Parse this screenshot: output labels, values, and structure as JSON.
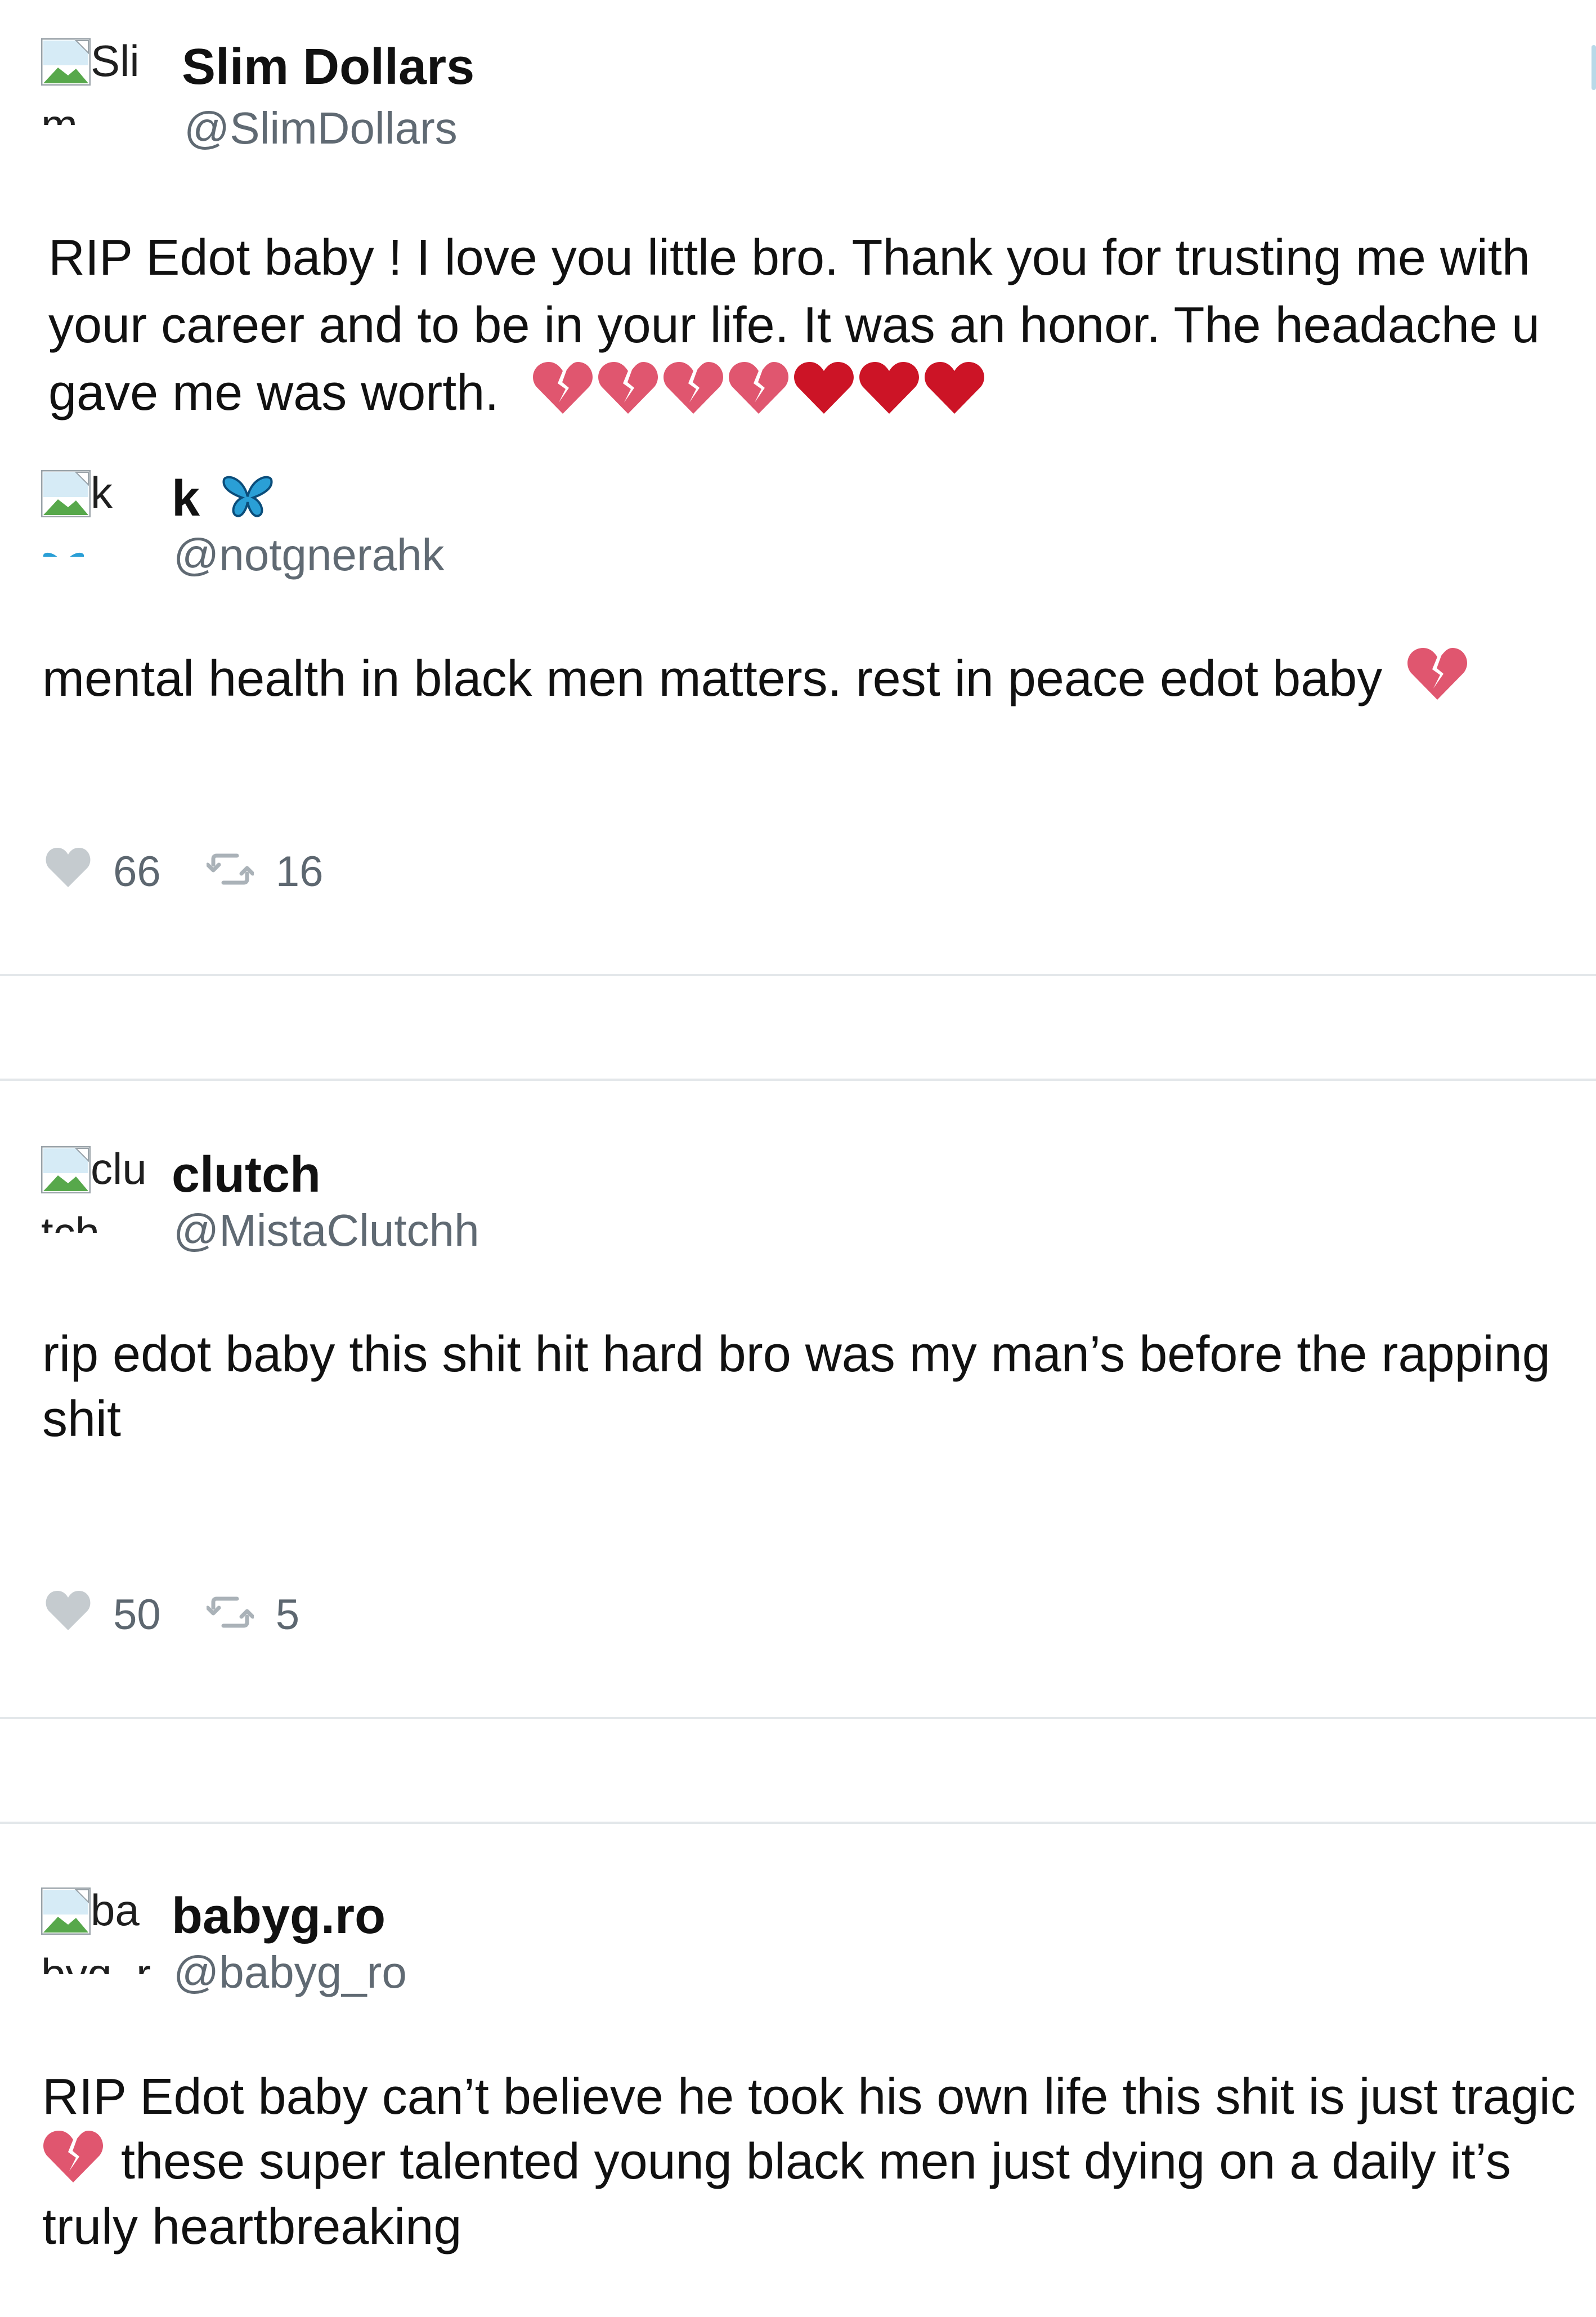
{
  "tweets": [
    {
      "name": "Slim Dollars",
      "handle": "@SlimDollars",
      "avatar_alt_1": "Sli",
      "avatar_alt_2": "m",
      "lines": [
        "RIP Edot baby ! I love you little bro. Thank you for trusting me with",
        "your career and to be in your life. It was an honor. The headache u",
        "gave me was worth."
      ],
      "emojis": [
        "broken-heart",
        "broken-heart",
        "broken-heart",
        "broken-heart",
        "red-heart",
        "red-heart",
        "red-heart"
      ]
    },
    {
      "name": "k",
      "handle": "@notgnerahk",
      "avatar_alt_1": "k",
      "name_emoji": "butterfly",
      "lines": [
        "mental health in black men matters. rest in peace edot baby"
      ],
      "emojis": [
        "broken-heart"
      ],
      "likes": "66",
      "retweets": "16"
    },
    {
      "name": "clutch",
      "handle": "@MistaClutchh",
      "avatar_alt_1": "clu",
      "avatar_alt_2": "tch",
      "lines": [
        "rip edot baby this shit hit hard bro was my man’s before the rapping",
        "shit"
      ],
      "likes": "50",
      "retweets": "5"
    },
    {
      "name": "babyg.ro",
      "handle": "@babyg_ro",
      "avatar_alt_1": "ba",
      "avatar_alt_2": "byg_r",
      "lines": [
        "RIP Edot baby can’t believe he took his own life this shit is just tragic",
        "these super talented young black men just dying on a daily it’s",
        "truly heartbreaking"
      ],
      "emojis": [
        "broken-heart"
      ]
    }
  ],
  "colors": {
    "text": "#111111",
    "handle": "#606a73",
    "stats": "#5d6770",
    "divider": "#e3e7ea",
    "broken_heart": "#e0566f",
    "red_heart": "#cc1426",
    "butterfly": "#2a9fd6"
  }
}
